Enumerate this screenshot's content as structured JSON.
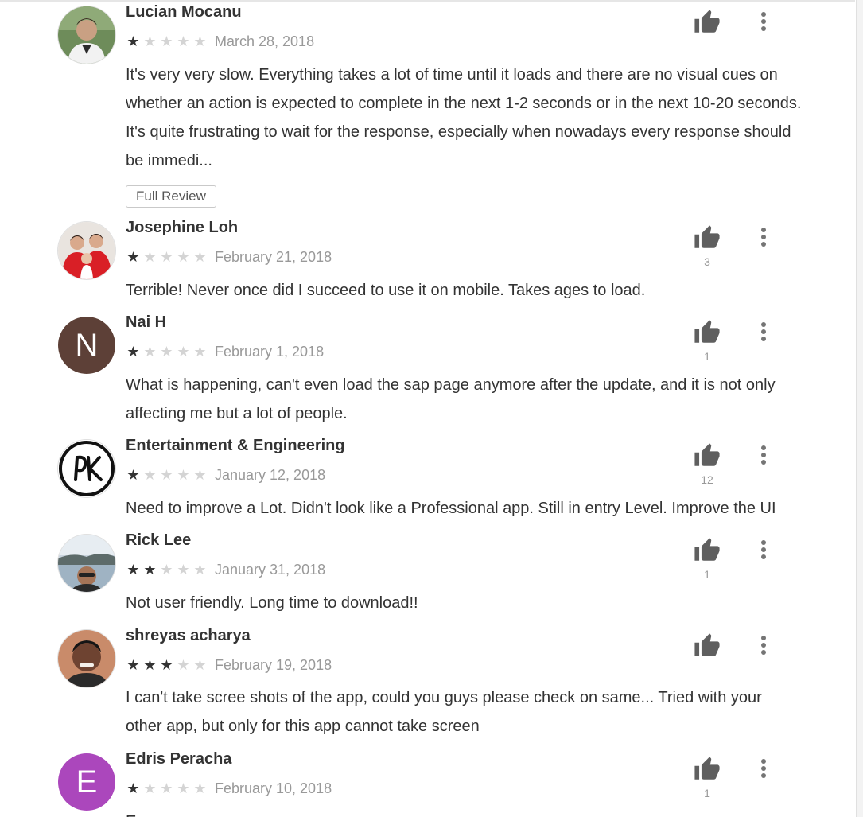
{
  "reviews": [
    {
      "author": "Lucian Mocanu",
      "rating": 1,
      "date": "March 28, 2018",
      "text": "It's very very slow. Everything takes a lot of time until it loads and there are no visual cues on whether an action is expected to complete in the next 1-2 seconds or in the next 10-20 seconds. It's quite frustrating to wait for the response, especially when nowadays every response should be immedi...",
      "helpful_count": "",
      "avatar": "photo"
    },
    {
      "author": "Josephine Loh",
      "rating": 1,
      "date": "February 21, 2018",
      "text": "Terrible! Never once did I succeed to use it on mobile. Takes ages to load.",
      "helpful_count": "3",
      "avatar": "photo"
    },
    {
      "author": "Nai H",
      "rating": 1,
      "date": "February 1, 2018",
      "text": "What is happening, can't even load the sap page anymore after the update, and it is not only affecting me but a lot of people.",
      "helpful_count": "1",
      "avatar": "letter",
      "avatar_letter": "N",
      "avatar_color": "#5d4037"
    },
    {
      "author": "Entertainment & Engineering",
      "rating": 1,
      "date": "January 12, 2018",
      "text": "Need to improve a Lot. Didn't look like a Professional app. Still in entry Level. Improve the UI",
      "helpful_count": "12",
      "avatar": "logo",
      "avatar_logo_text": "PK"
    },
    {
      "author": "Rick Lee",
      "rating": 2,
      "date": "January 31, 2018",
      "text": "Not user friendly. Long time to download!!",
      "helpful_count": "1",
      "avatar": "photo"
    },
    {
      "author": "shreyas acharya",
      "rating": 3,
      "date": "February 19, 2018",
      "text": "I can't take scree shots of the app, could you guys please check on same... Tried with your other app, but only for this app cannot take screen",
      "helpful_count": "",
      "avatar": "photo"
    },
    {
      "author": "Edris Peracha",
      "rating": 1,
      "date": "February 10, 2018",
      "text": "Exce..",
      "helpful_count": "1",
      "avatar": "letter",
      "avatar_letter": "E",
      "avatar_color": "#ab47bc"
    }
  ],
  "full_review_label": "Full Review",
  "icons": {
    "helpful": "thumb-up-icon",
    "menu": "more-vert-icon"
  },
  "colors": {
    "star_on": "#333333",
    "star_off": "#d4d4d4",
    "meta_text": "#999999"
  }
}
